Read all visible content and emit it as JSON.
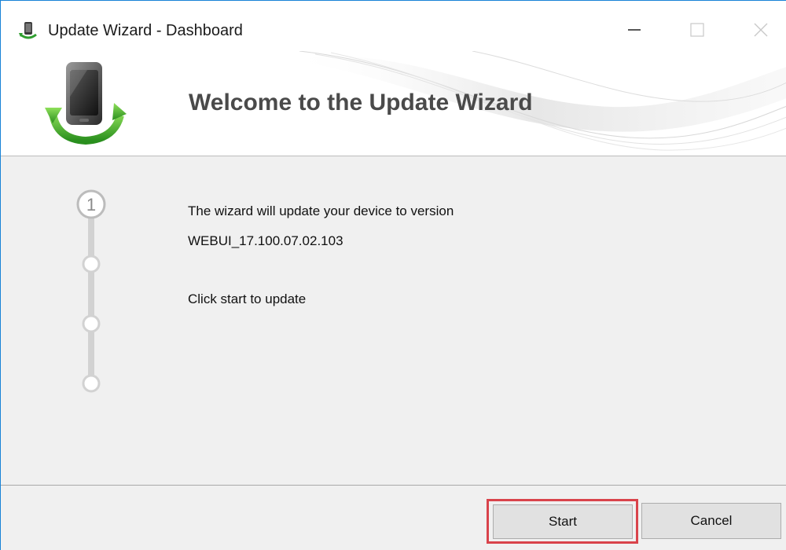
{
  "window": {
    "title": "Update Wizard - Dashboard",
    "title_icon": "phone-update-icon",
    "controls": [
      "minimize-icon",
      "maximize-icon",
      "close-icon"
    ]
  },
  "header": {
    "title": "Welcome to the Update Wizard",
    "logo_icon": "phone-sync-icon"
  },
  "stepper": {
    "current_step": "1",
    "total_steps": 4
  },
  "main": {
    "line1": "The wizard will update your device to version",
    "version": "WEBUI_17.100.07.02.103",
    "instruction": "Click start to update"
  },
  "footer": {
    "start_label": "Start",
    "cancel_label": "Cancel"
  },
  "colors": {
    "highlight": "#d9434b",
    "window_border": "#1883d7",
    "title_text": "#4a4a4a",
    "background": "#f0f0f0"
  }
}
